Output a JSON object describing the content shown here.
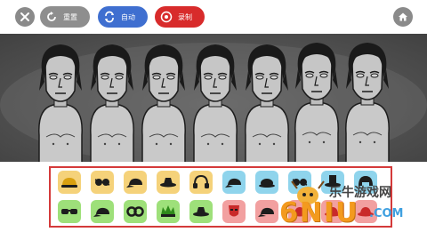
{
  "toolbar": {
    "reset_label": "重置",
    "auto_label": "自动",
    "record_label": "录制",
    "colors": {
      "reset": "#8e8e8e",
      "auto": "#3f6fd0",
      "record": "#d82b2b",
      "round": "#8a8a8a"
    }
  },
  "stage": {
    "performer_count": 7,
    "background": "#5a5a5a"
  },
  "sound_icons": {
    "row1": [
      {
        "name": "beat-hat-1",
        "color": "#f5d27a",
        "icon": "hard-hat-icon"
      },
      {
        "name": "beat-glasses-1",
        "color": "#f5d27a",
        "icon": "glasses-icon"
      },
      {
        "name": "beat-cap-1",
        "color": "#f5d27a",
        "icon": "cap-icon"
      },
      {
        "name": "beat-hat-2",
        "color": "#f5d27a",
        "icon": "fedora-icon"
      },
      {
        "name": "beat-headphones-1",
        "color": "#f5d27a",
        "icon": "headphones-icon"
      },
      {
        "name": "effect-cap-1",
        "color": "#8fd4ec",
        "icon": "cap-icon"
      },
      {
        "name": "effect-hat-1",
        "color": "#8fd4ec",
        "icon": "bowler-icon"
      },
      {
        "name": "effect-glasses-1",
        "color": "#8fd4ec",
        "icon": "glasses-icon"
      },
      {
        "name": "effect-hat-2",
        "color": "#8fd4ec",
        "icon": "top-hat-icon"
      },
      {
        "name": "effect-helmet-1",
        "color": "#8fd4ec",
        "icon": "helmet-icon"
      }
    ],
    "row2": [
      {
        "name": "melody-glasses-1",
        "color": "#9ee07a",
        "icon": "sunglasses-icon"
      },
      {
        "name": "melody-cap-1",
        "color": "#9ee07a",
        "icon": "cap-icon"
      },
      {
        "name": "melody-goggles-1",
        "color": "#9ee07a",
        "icon": "goggles-icon"
      },
      {
        "name": "melody-crown-1",
        "color": "#9ee07a",
        "icon": "leaf-crown-icon"
      },
      {
        "name": "melody-hat-1",
        "color": "#9ee07a",
        "icon": "fedora-icon"
      },
      {
        "name": "voice-mask-1",
        "color": "#f2a0a0",
        "icon": "mask-icon"
      },
      {
        "name": "voice-hat-1",
        "color": "#f2a0a0",
        "icon": "cap-icon"
      },
      {
        "name": "voice-hat-2",
        "color": "#f2a0a0",
        "icon": "hat-icon"
      },
      {
        "name": "voice-hat-3",
        "color": "#f2a0a0",
        "icon": "hat-icon"
      },
      {
        "name": "voice-hat-4",
        "color": "#f2a0a0",
        "icon": "hat-icon"
      }
    ]
  },
  "watermark": {
    "site_name": "乐牛游戏网",
    "logo_text": "6NIU",
    "domain_suffix": ".COM"
  }
}
